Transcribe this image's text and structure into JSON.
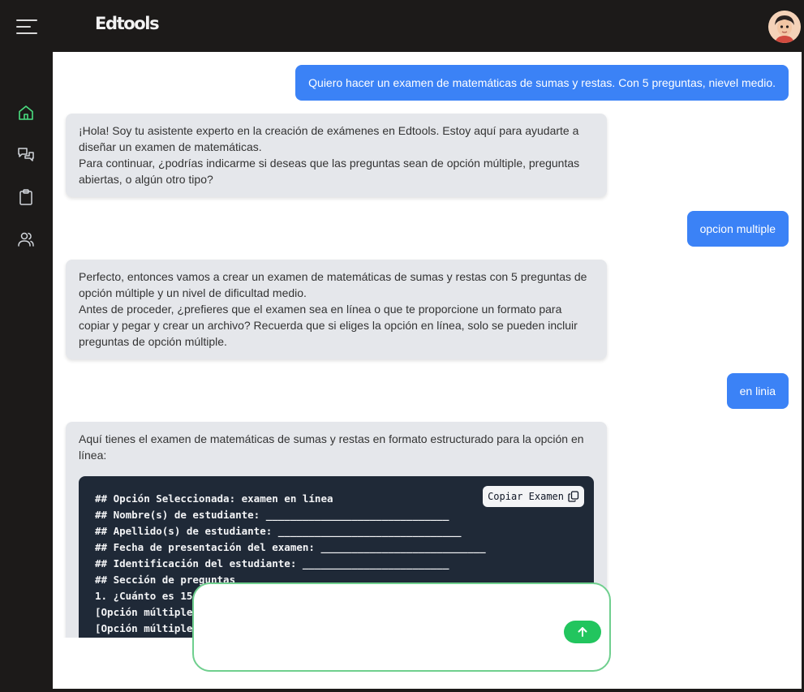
{
  "app": {
    "logo": "Edtools"
  },
  "icons": {
    "menu": "hamburger-menu-icon",
    "home": "home-icon",
    "chats": "chat-bubbles-icon",
    "exams": "clipboard-icon",
    "users": "users-icon",
    "copy": "copy-icon",
    "send": "arrow-up-icon"
  },
  "colors": {
    "accent_green": "#22c55e",
    "user_bubble": "#3b82f6",
    "bot_bubble": "#e5e7eb",
    "code_bg": "#1f2937",
    "sidebar_bg": "#1c1a19"
  },
  "messages": {
    "user1": "Quiero hacer un examen de matemáticas de sumas y restas. Con 5 preguntas, nievel medio.",
    "bot1": [
      "¡Hola! Soy tu asistente experto en la creación de exámenes en Edtools. Estoy aquí para ayudarte a diseñar un examen de matemáticas.",
      "Para continuar, ¿podrías indicarme si deseas que las preguntas sean de opción múltiple, preguntas abiertas, o algún otro tipo?"
    ],
    "user2": "opcion multiple",
    "bot2": [
      "Perfecto, entonces vamos a crear un examen de matemáticas de sumas y restas con 5 preguntas de opción múltiple y un nivel de dificultad medio.",
      "Antes de proceder, ¿prefieres que el examen sea en línea o que te proporcione un formato para copiar y pegar y crear un archivo? Recuerda que si eliges la opción en línea, solo se pueden incluir preguntas de opción múltiple."
    ],
    "user3": "en linia",
    "bot3_intro": "Aquí tienes el examen de matemáticas de sumas y restas en formato estructurado para la opción en línea:",
    "code": {
      "copy_label": "Copiar Examen",
      "lines": [
        "## Opción Seleccionada: examen en línea",
        "## Nombre(s) de estudiante: ______________________________",
        "## Apellido(s) de estudiante: ______________________________",
        "## Fecha de presentación del examen: ___________________________",
        "## Identificación del estudiante: ________________________",
        "## Sección de preguntas",
        "1. ¿Cuánto es 15",
        "[Opción múltiple",
        "[Opción múltiple"
      ]
    }
  },
  "composer": {
    "placeholder": "",
    "value": ""
  }
}
